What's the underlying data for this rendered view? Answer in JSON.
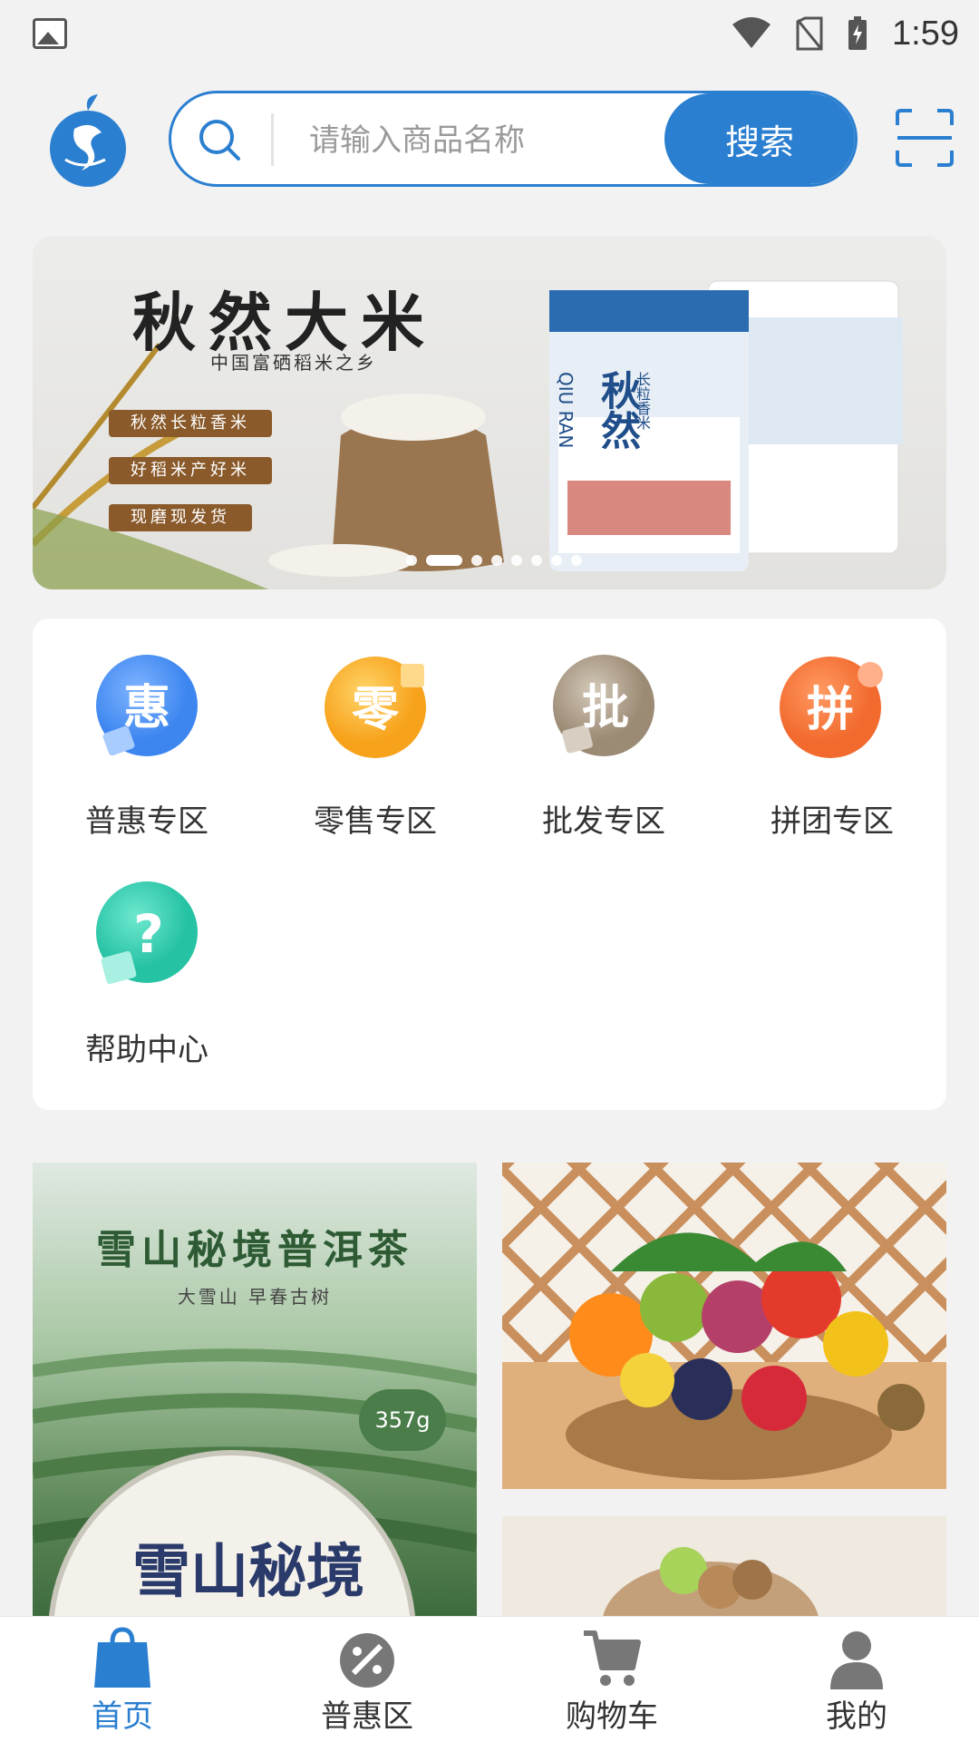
{
  "status_bar": {
    "time": "1:59",
    "icons": [
      "image-icon",
      "wifi-icon",
      "no-sim-icon",
      "battery-charging-icon"
    ]
  },
  "header": {
    "logo": "brand-logo",
    "search": {
      "placeholder": "请输入商品名称",
      "button_label": "搜索",
      "icon": "search-icon"
    },
    "scan_icon": "scan-icon"
  },
  "banner": {
    "title": "秋然大米",
    "subtitle": "中国富硒稻米之乡",
    "tags": [
      "秋然长粒香米",
      "好稻米产好米",
      "现磨现发货"
    ],
    "package_text": "秋然",
    "package_latin": "QIU RAN",
    "package_variety": "长粒香米",
    "slide_count": 8,
    "active_slide": 2
  },
  "categories": [
    {
      "label": "普惠专区",
      "icon": "hui-icon",
      "glyph": "惠",
      "color": "#3d86f0"
    },
    {
      "label": "零售专区",
      "icon": "ling-icon",
      "glyph": "零",
      "color": "#f7a21b"
    },
    {
      "label": "批发专区",
      "icon": "pi-icon",
      "glyph": "批",
      "color": "#9b8a74"
    },
    {
      "label": "拼团专区",
      "icon": "pin-icon",
      "glyph": "拼",
      "color": "#f26a2e"
    },
    {
      "label": "帮助中心",
      "icon": "help-icon",
      "glyph": "?",
      "color": "#26c2a4"
    }
  ],
  "products": {
    "tea": {
      "title": "雪山秘境普洱茶",
      "subtitle": "大雪山 早春古树",
      "weight": "357g",
      "cake_text": "雪山秘境"
    },
    "fruit": {
      "name": "fruit-basket"
    },
    "nuts": {
      "name": "walnuts"
    }
  },
  "tabbar": [
    {
      "label": "首页",
      "icon": "home-bag-icon",
      "active": true
    },
    {
      "label": "普惠区",
      "icon": "discount-icon",
      "active": false
    },
    {
      "label": "购物车",
      "icon": "cart-icon",
      "active": false
    },
    {
      "label": "我的",
      "icon": "user-icon",
      "active": false
    }
  ],
  "colors": {
    "primary": "#2b7fd0",
    "background": "#f2f2f2"
  }
}
